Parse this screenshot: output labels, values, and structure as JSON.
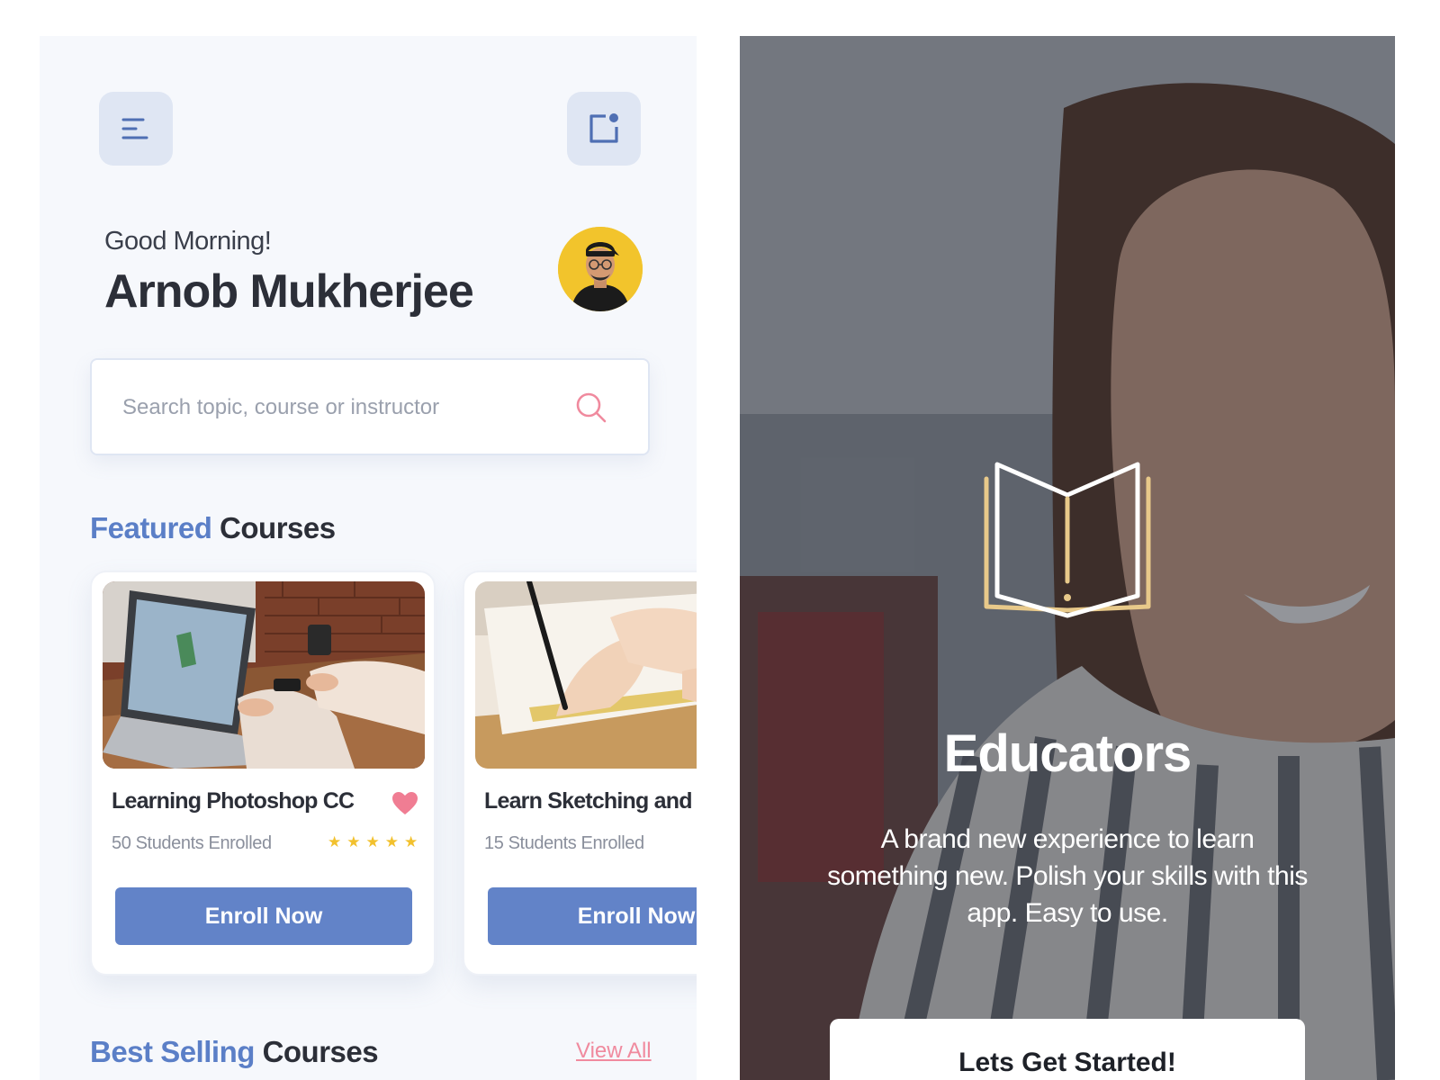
{
  "home": {
    "greeting": "Good Morning!",
    "user_name": "Arnob Mukherjee",
    "search": {
      "placeholder": "Search topic, course or instructor"
    },
    "featured": {
      "accent": "Featured",
      "rest": "Courses"
    },
    "best_selling": {
      "accent": "Best Selling",
      "rest": "Courses",
      "view_all": "View All"
    },
    "courses": [
      {
        "title": "Learning Photoshop CC",
        "enrolled": "50 Students Enrolled",
        "rating": 5,
        "stars": "★★★★★",
        "favorited": true,
        "button": "Enroll Now"
      },
      {
        "title": "Learn Sketching and",
        "enrolled": "15 Students Enrolled",
        "button": "Enroll Now"
      }
    ],
    "icons": {
      "menu": "menu-icon",
      "notification": "notification-icon",
      "search": "search-icon",
      "favorite": "heart-icon",
      "rating": "star-icon"
    }
  },
  "welcome": {
    "logo": "open-book-icon",
    "title": "Educators",
    "tagline": "A brand new experience to learn something new. Polish your skills  with this app. Easy to use.",
    "cta": "Lets Get Started!"
  },
  "colors": {
    "accent_blue": "#5b7fc7",
    "button_blue": "#6283c8",
    "pink": "#f08a9e",
    "star_yellow": "#f2c12e",
    "logo_gold": "#e8c98a",
    "icon_tile": "#dfe6f3"
  }
}
